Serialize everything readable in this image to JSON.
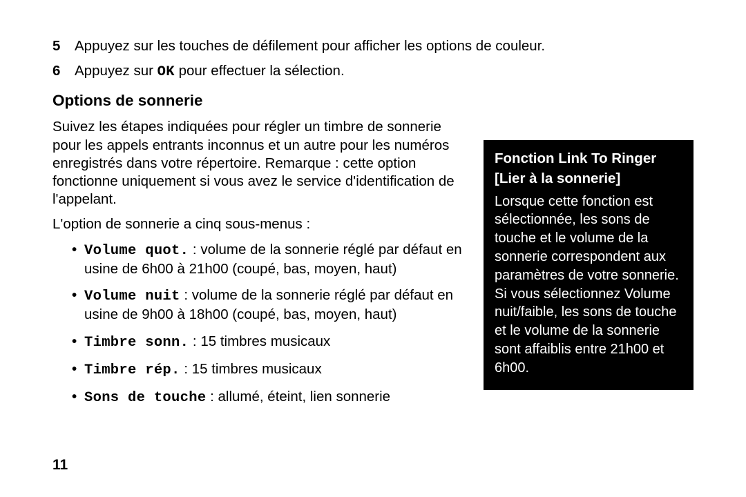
{
  "steps": [
    {
      "num": "5",
      "text": "Appuyez sur les touches de défilement pour afficher les options de couleur."
    },
    {
      "num": "6",
      "prefix": "Appuyez sur ",
      "key": "OK",
      "suffix": " pour effectuer la sélection."
    }
  ],
  "section_title": "Options de sonnerie",
  "intro": "Suivez les étapes indiquées pour régler un timbre de sonnerie pour les appels entrants inconnus et un autre pour les numéros enregistrés dans votre répertoire. Remarque : cette option fonctionne uniquement si vous avez le service d'identification de l'appelant.",
  "submenus_lead": "L'option de sonnerie a cinq sous-menus :",
  "bullets": [
    {
      "label": "Volume quot.",
      "text": " : volume de la sonnerie réglé par défaut en usine de 6h00 à 21h00 (coupé, bas, moyen, haut)"
    },
    {
      "label": "Volume nuit",
      "text": " : volume de la sonnerie réglé par défaut en usine de 9h00 à 18h00 (coupé, bas, moyen, haut)"
    },
    {
      "label": "Timbre sonn.",
      "text": " : 15 timbres musicaux"
    },
    {
      "label": "Timbre rép.",
      "text": " : 15 timbres musicaux"
    },
    {
      "label": "Sons de touche",
      "text": " : allumé, éteint, lien sonnerie"
    }
  ],
  "sidebar": {
    "title": "Fonction Link To Ringer",
    "subtitle": "[Lier à la sonnerie]",
    "body": "Lorsque cette fonction est sélectionnée, les sons de touche et le volume de la sonnerie correspondent aux paramètres de votre sonnerie. Si vous sélectionnez Volume nuit/faible, les sons de touche et le volume de la sonnerie sont affaiblis entre 21h00 et 6h00."
  },
  "page_number": "11"
}
